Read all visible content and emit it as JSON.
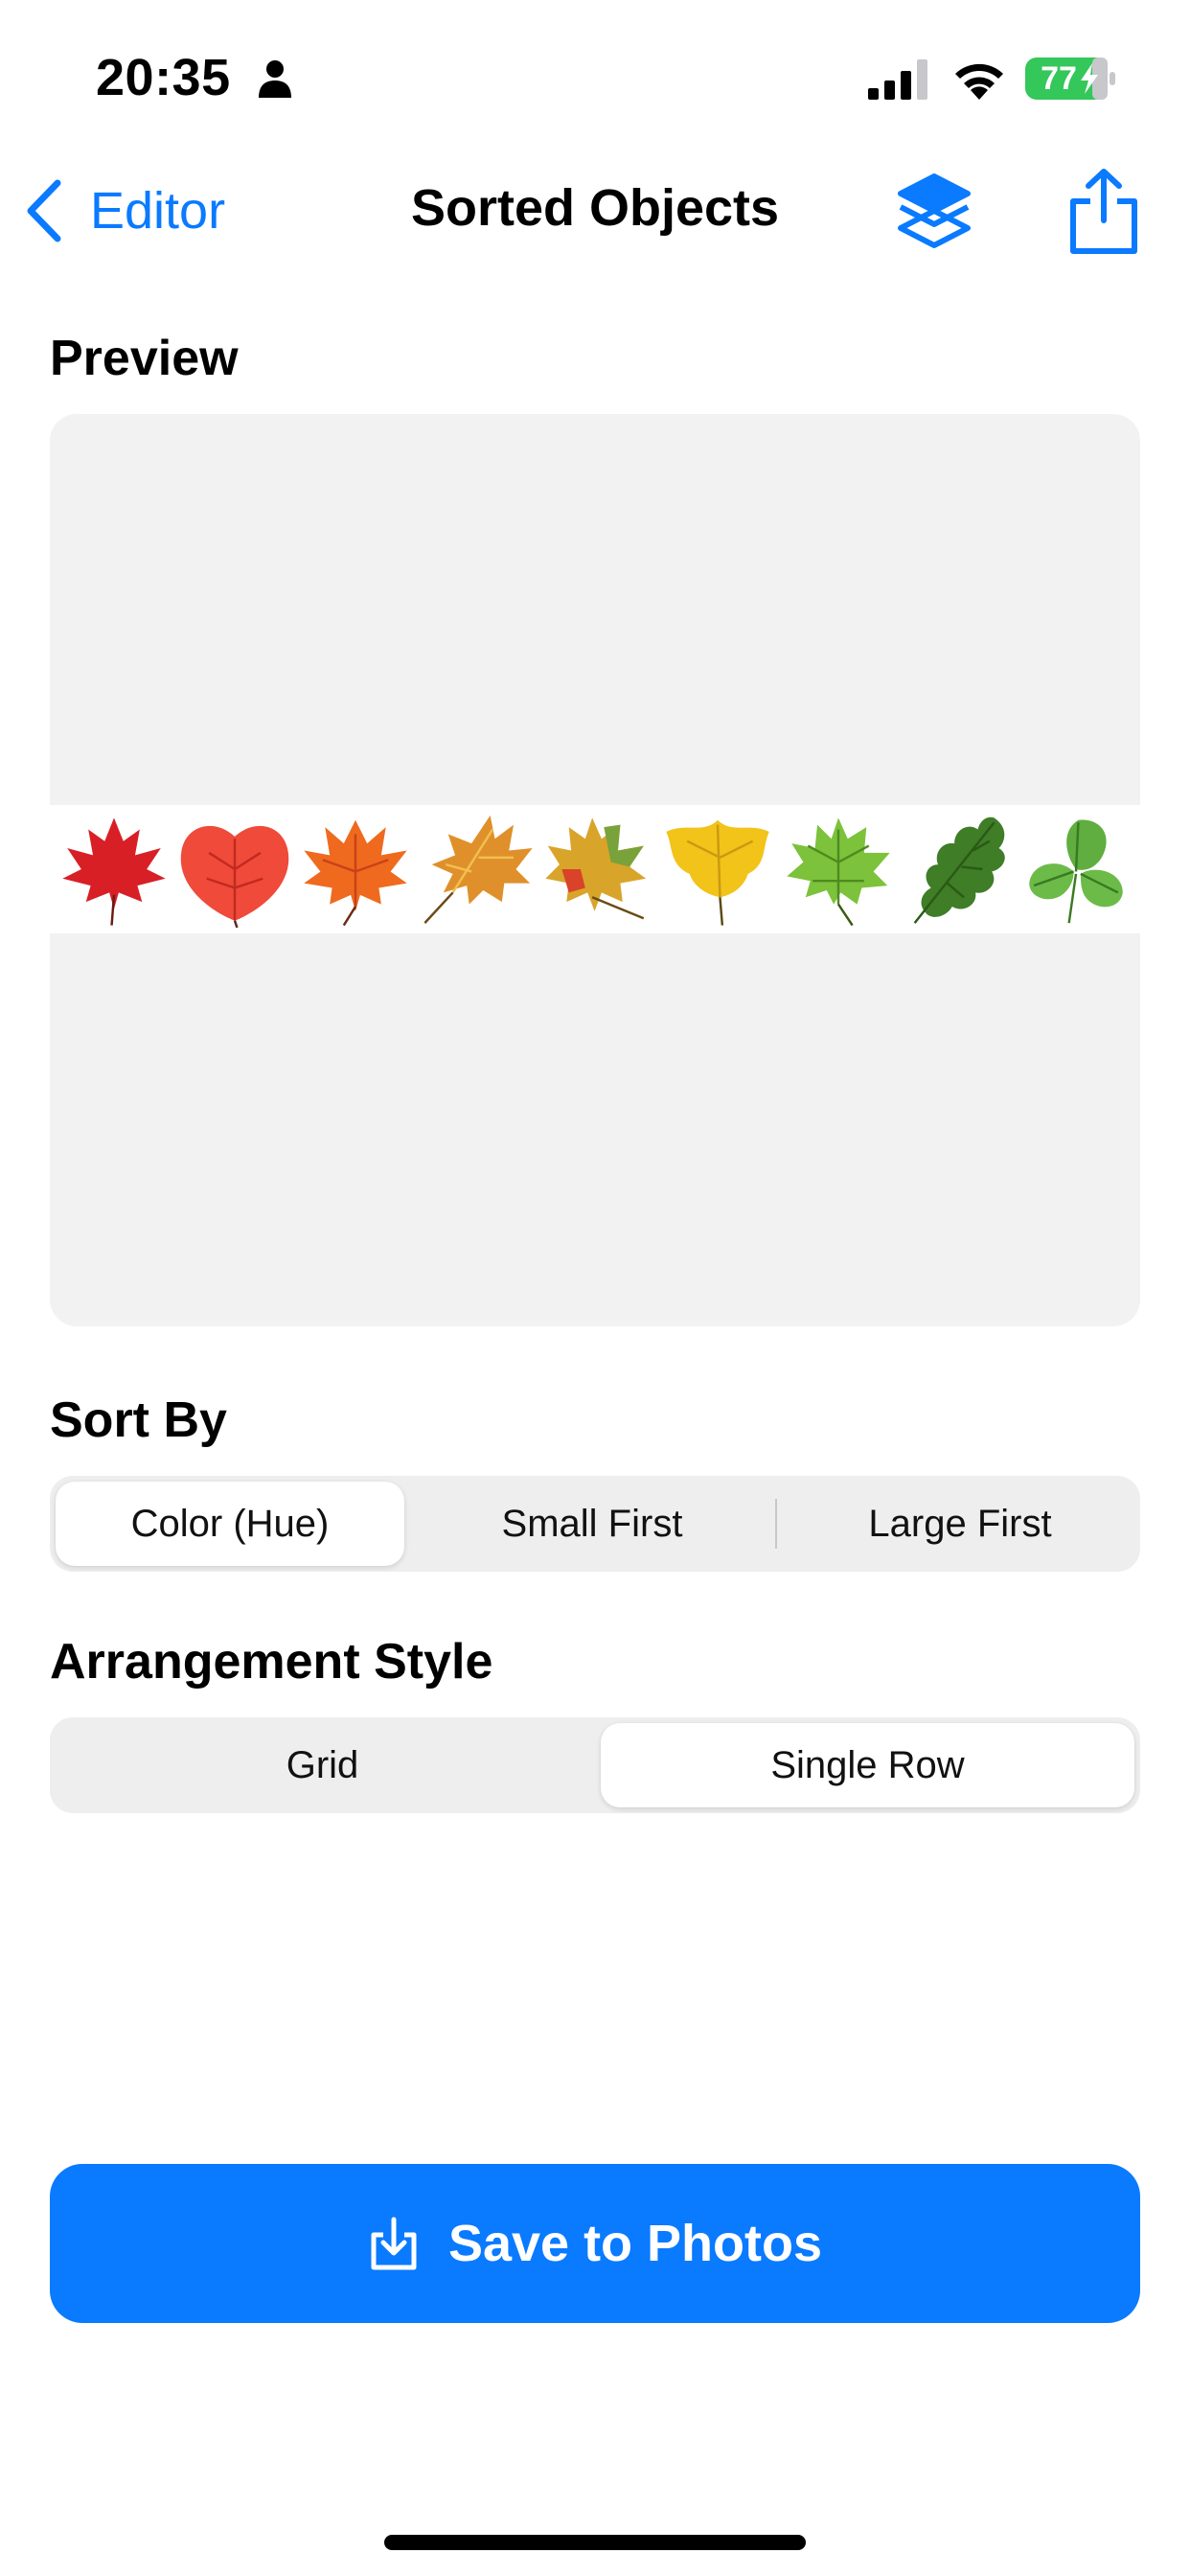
{
  "status_bar": {
    "time": "20:35",
    "battery": "77",
    "icons": [
      "person-icon",
      "signal-icon",
      "wifi-icon",
      "battery-charging-icon"
    ]
  },
  "nav": {
    "back_label": "Editor",
    "title": "Sorted Objects",
    "icons": [
      "chevron-left-icon",
      "layers-icon",
      "share-icon"
    ]
  },
  "preview": {
    "title": "Preview",
    "leaves": [
      {
        "name": "red-maple-leaf",
        "color": "#d81f26"
      },
      {
        "name": "red-round-leaf",
        "color": "#ef4a3a"
      },
      {
        "name": "orange-maple-leaf",
        "color": "#ef6a1e"
      },
      {
        "name": "orange-oak-maple-leaf",
        "color": "#e0902a"
      },
      {
        "name": "mixed-autumn-leaf",
        "color": "#d9a42a"
      },
      {
        "name": "yellow-leaf",
        "color": "#f2c319"
      },
      {
        "name": "light-green-leaf",
        "color": "#7cc23a"
      },
      {
        "name": "dark-green-oak-leaf",
        "color": "#3f7d26"
      },
      {
        "name": "green-trifoliate-leaf",
        "color": "#5fae3f"
      }
    ]
  },
  "sort_by": {
    "title": "Sort By",
    "options": [
      "Color (Hue)",
      "Small First",
      "Large First"
    ],
    "selected": "Color (Hue)"
  },
  "arrangement": {
    "title": "Arrangement Style",
    "options": [
      "Grid",
      "Single Row"
    ],
    "selected": "Single Row"
  },
  "save_button": {
    "label": "Save to Photos",
    "icon": "save-download-icon",
    "color": "#0a7aff"
  },
  "colors": {
    "accent": "#0a7aff",
    "battery_green": "#34c759",
    "preview_bg": "#f2f2f2",
    "segment_bg": "#eeeeef"
  }
}
